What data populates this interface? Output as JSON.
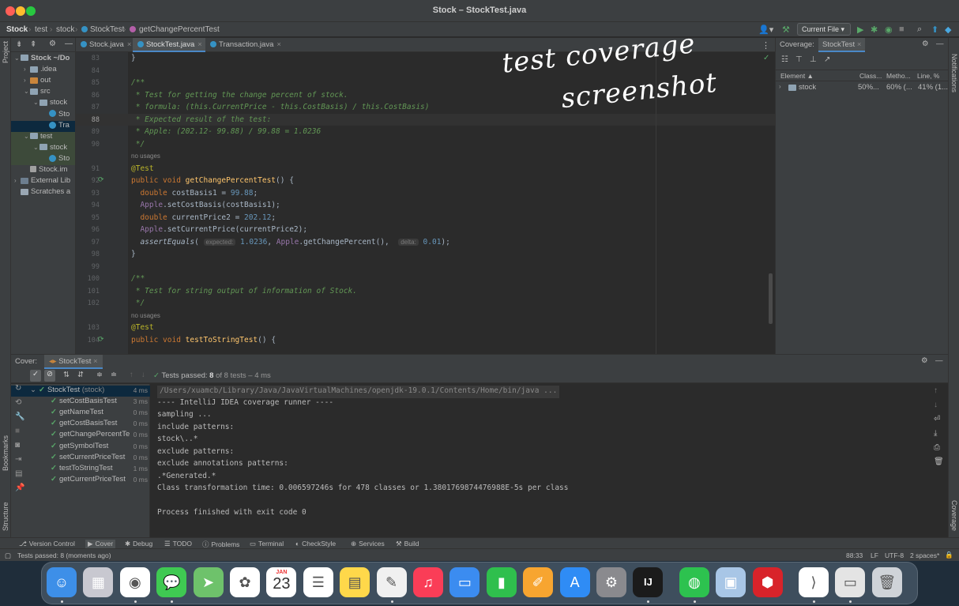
{
  "window": {
    "title": "Stock – StockTest.java"
  },
  "navbar": {
    "crumbs": [
      "Stock",
      "test",
      "stock",
      "StockTest",
      "getChangePercentTest"
    ],
    "run_config": "Current File"
  },
  "left_strip": {
    "project": "Project",
    "bookmarks": "Bookmarks",
    "structure": "Structure"
  },
  "right_strip": {
    "notifications": "Notifications",
    "coverage": "Coverage"
  },
  "project_tree": [
    {
      "label": "Stock ~/Do",
      "indent": 0,
      "kind": "folder",
      "arrow": "v"
    },
    {
      "label": ".idea",
      "indent": 1,
      "kind": "folder",
      "arrow": ">"
    },
    {
      "label": "out",
      "indent": 1,
      "kind": "folder-orange",
      "arrow": ">"
    },
    {
      "label": "src",
      "indent": 1,
      "kind": "folder",
      "arrow": "v"
    },
    {
      "label": "stock",
      "indent": 2,
      "kind": "folder",
      "arrow": "v"
    },
    {
      "label": "Sto",
      "indent": 3,
      "kind": "class",
      "arrow": ""
    },
    {
      "label": "Tra",
      "indent": 3,
      "kind": "class",
      "arrow": "",
      "selected": true
    },
    {
      "label": "test",
      "indent": 1,
      "kind": "folder",
      "arrow": "v",
      "hl": true
    },
    {
      "label": "stock",
      "indent": 2,
      "kind": "folder",
      "arrow": "v",
      "hl": true
    },
    {
      "label": "Sto",
      "indent": 3,
      "kind": "class",
      "arrow": "",
      "hl": true
    },
    {
      "label": "Stock.im",
      "indent": 1,
      "kind": "file",
      "arrow": ""
    },
    {
      "label": "External Lib",
      "indent": 0,
      "kind": "lib",
      "arrow": ">"
    },
    {
      "label": "Scratches a",
      "indent": 0,
      "kind": "scratch",
      "arrow": ""
    }
  ],
  "editor_tabs": [
    {
      "label": "Stock.java",
      "active": false
    },
    {
      "label": "StockTest.java",
      "active": true
    },
    {
      "label": "Transaction.java",
      "active": false
    }
  ],
  "code_lines": [
    {
      "n": "83",
      "html": "<span>}</span>"
    },
    {
      "n": "84",
      "html": ""
    },
    {
      "n": "85",
      "html": "<span class='c-cm'>/**</span>"
    },
    {
      "n": "86",
      "html": "<span class='c-cm'> * Test for getting the change percent of stock.</span>"
    },
    {
      "n": "87",
      "html": "<span class='c-cm'> * formula: (this.CurrentPrice - this.CostBasis) / this.CostBasis)</span>"
    },
    {
      "n": "88",
      "html": "<span class='c-cm'> * Expected result of the test:</span>",
      "cur": true
    },
    {
      "n": "89",
      "html": "<span class='c-cm'> * Apple: (202.12- 99.88) / 99.88 = 1.0236</span>"
    },
    {
      "n": "90",
      "html": "<span class='c-cm'> */</span>"
    },
    {
      "n": "",
      "html": "<span class='c-usage'>no usages</span>"
    },
    {
      "n": "91",
      "html": "<span class='c-ann'>@Test</span>"
    },
    {
      "n": "92",
      "html": "<span class='c-kw'>public void </span><span class='c-fn'>getChangePercentTest</span>() {",
      "run": true
    },
    {
      "n": "93",
      "html": "  <span class='c-kw'>double </span>costBasis1 = <span class='c-num'>99.88</span>;"
    },
    {
      "n": "94",
      "html": "  <span class='c-var'>Apple</span>.setCostBasis(costBasis1);"
    },
    {
      "n": "95",
      "html": "  <span class='c-kw'>double </span>currentPrice2 = <span class='c-num'>202.12</span>;"
    },
    {
      "n": "96",
      "html": "  <span class='c-var'>Apple</span>.setCurrentPrice(currentPrice2);"
    },
    {
      "n": "97",
      "html": "  <i>assertEquals</i>( <span class='c-hint'>expected:</span> <span class='c-num'>1.0236</span>, <span class='c-var'>Apple</span>.getChangePercent(),  <span class='c-hint'>delta:</span> <span class='c-num'>0.01</span>);"
    },
    {
      "n": "98",
      "html": "}"
    },
    {
      "n": "99",
      "html": ""
    },
    {
      "n": "100",
      "html": "<span class='c-cm'>/**</span>"
    },
    {
      "n": "101",
      "html": "<span class='c-cm'> * Test for string output of information of Stock.</span>"
    },
    {
      "n": "102",
      "html": "<span class='c-cm'> */</span>"
    },
    {
      "n": "",
      "html": "<span class='c-usage'>no usages</span>"
    },
    {
      "n": "103",
      "html": "<span class='c-ann'>@Test</span>"
    },
    {
      "n": "104",
      "html": "<span class='c-kw'>public void </span><span class='c-fn'>testToStringTest</span>() {",
      "run": true
    }
  ],
  "coverage_panel": {
    "title": "Coverage:",
    "tab": "StockTest",
    "columns": [
      "Element",
      "Class...",
      "Metho...",
      "Line, %"
    ],
    "row": {
      "name": "stock",
      "class": "50%...",
      "method": "60% (...",
      "line": "41% (1..."
    }
  },
  "annotation": {
    "line1": "test coverage",
    "line2": "screenshot"
  },
  "bottom_panel": {
    "label": "Cover:",
    "tab": "StockTest",
    "status_prefix": "Tests passed:",
    "status_count": "8",
    "status_suffix": "of 8 tests – 4 ms"
  },
  "test_tree": [
    {
      "label": "StockTest",
      "suffix": "(stock)",
      "dur": "4 ms",
      "root": true
    },
    {
      "label": "setCostBasisTest",
      "dur": "3 ms"
    },
    {
      "label": "getNameTest",
      "dur": "0 ms"
    },
    {
      "label": "getCostBasisTest",
      "dur": "0 ms"
    },
    {
      "label": "getChangePercentTe",
      "dur": "0 ms"
    },
    {
      "label": "getSymbolTest",
      "dur": "0 ms"
    },
    {
      "label": "setCurrentPriceTest",
      "dur": "0 ms"
    },
    {
      "label": "testToStringTest",
      "dur": "1 ms"
    },
    {
      "label": "getCurrentPriceTest",
      "dur": "0 ms"
    }
  ],
  "console_lines": [
    "/Users/xuamcb/Library/Java/JavaVirtualMachines/openjdk-19.0.1/Contents/Home/bin/java ...",
    "---- IntelliJ IDEA coverage runner ----",
    "sampling ...",
    "include patterns:",
    "stock\\..*",
    "exclude patterns:",
    "exclude annotations patterns:",
    ".*Generated.*",
    "Class transformation time: 0.006597246s for 478 classes or 1.3801769874476988E-5s per class",
    "",
    "Process finished with exit code 0"
  ],
  "tool_windows": [
    "Version Control",
    "Cover",
    "Debug",
    "TODO",
    "Problems",
    "Terminal",
    "CheckStyle",
    "Services",
    "Build"
  ],
  "statusbar": {
    "left": "Tests passed: 8 (moments ago)",
    "pos": "88:33",
    "lf": "LF",
    "enc": "UTF-8",
    "indent": "2 spaces*"
  },
  "dock": [
    {
      "name": "finder",
      "color": "#3d8fe8",
      "label": ""
    },
    {
      "name": "launchpad",
      "color": "#c8c8d0",
      "label": ""
    },
    {
      "name": "chrome",
      "color": "#ffffff",
      "label": ""
    },
    {
      "name": "messages",
      "color": "#3fc952",
      "label": ""
    },
    {
      "name": "maps",
      "color": "#6ec26b",
      "label": ""
    },
    {
      "name": "photos",
      "color": "#ffffff",
      "label": ""
    },
    {
      "name": "calendar",
      "color": "#ffffff",
      "label": "23",
      "month": "JAN"
    },
    {
      "name": "reminders",
      "color": "#ffffff",
      "label": ""
    },
    {
      "name": "notes",
      "color": "#ffd84a",
      "label": ""
    },
    {
      "name": "textedit",
      "color": "#f0f0f0",
      "label": ""
    },
    {
      "name": "music",
      "color": "#fa3d57",
      "label": ""
    },
    {
      "name": "keynote",
      "color": "#3b8cf0",
      "label": ""
    },
    {
      "name": "numbers",
      "color": "#2fbf4d",
      "label": ""
    },
    {
      "name": "pages",
      "color": "#f7a530",
      "label": ""
    },
    {
      "name": "app-store",
      "color": "#2f8cf5",
      "label": ""
    },
    {
      "name": "system-settings",
      "color": "#8a8a8e",
      "label": ""
    },
    {
      "name": "intellij",
      "color": "#1b1b1b",
      "label": "IJ"
    },
    {
      "name": "wechat",
      "color": "#2dc24f",
      "label": ""
    },
    {
      "name": "preview",
      "color": "#a8c6e6",
      "label": ""
    },
    {
      "name": "security",
      "color": "#d8232a",
      "label": ""
    },
    {
      "name": "vscode",
      "color": "#ffffff",
      "label": ""
    },
    {
      "name": "screenshot",
      "color": "#e4e4e4",
      "label": ""
    },
    {
      "name": "trash",
      "color": "#cfd3d8",
      "label": ""
    }
  ]
}
